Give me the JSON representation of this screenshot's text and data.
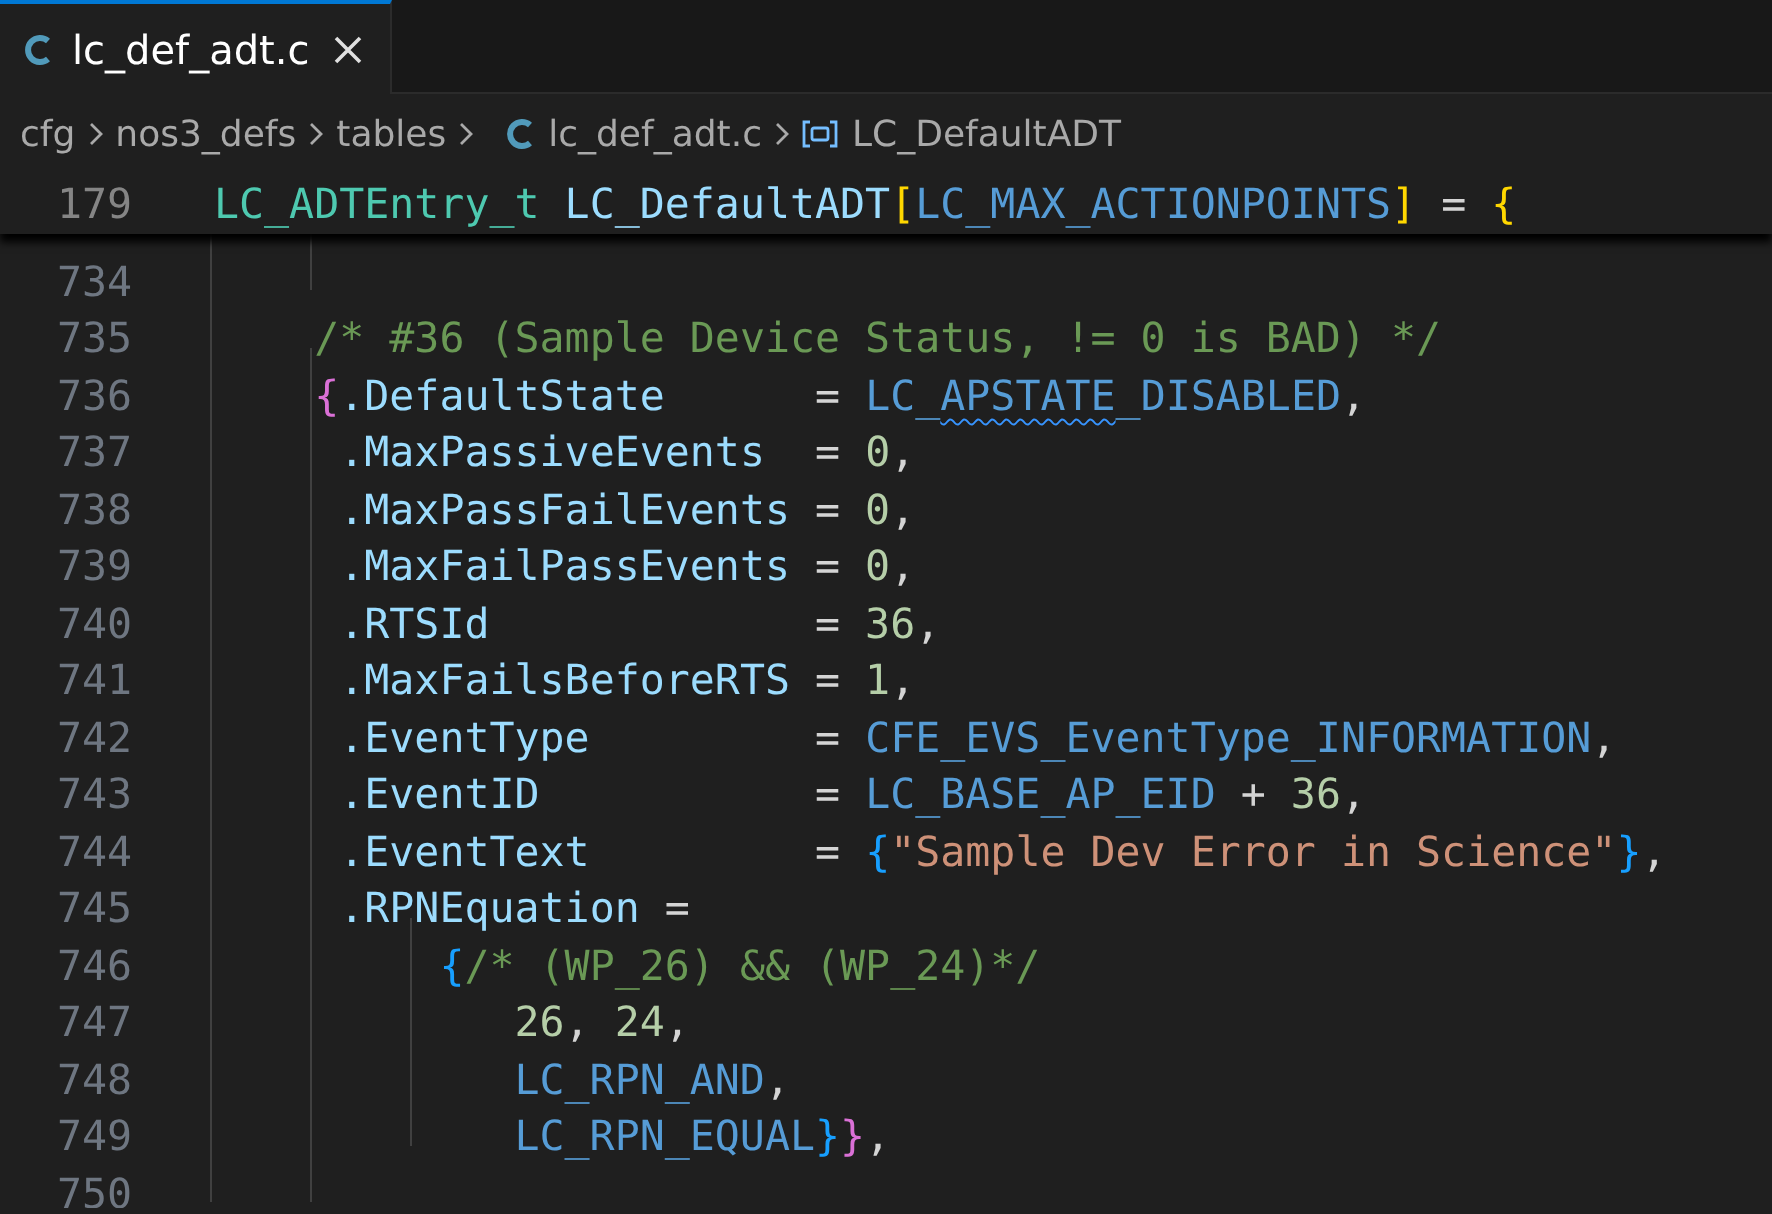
{
  "tabs": [
    {
      "label": "lc_def_adt.c",
      "selected": true
    }
  ],
  "breadcrumbs": [
    {
      "label": "cfg",
      "kind": "folder"
    },
    {
      "label": "nos3_defs",
      "kind": "folder"
    },
    {
      "label": "tables",
      "kind": "folder"
    },
    {
      "label": "lc_def_adt.c",
      "kind": "file"
    },
    {
      "label": "LC_DefaultADT",
      "kind": "symbol"
    }
  ],
  "sticky_line": {
    "number": "179",
    "tokens": [
      {
        "text": "LC_ADTEntry_t",
        "kind": "type"
      },
      {
        "text": " LC_DefaultADT",
        "kind": "variable"
      },
      {
        "text": "[",
        "kind": "bracket_gold"
      },
      {
        "text": "LC_MAX_ACTIONPOINTS",
        "kind": "macro"
      },
      {
        "text": "]",
        "kind": "bracket_gold"
      },
      {
        "text": " = ",
        "kind": "operator"
      },
      {
        "text": "{",
        "kind": "bracket_gold"
      }
    ]
  },
  "lines": [
    {
      "number": "734"
    },
    {
      "number": "735",
      "tokens": [
        {
          "text": "    /* #36 (Sample Device Status, != 0 is BAD) */",
          "kind": "comment"
        }
      ]
    },
    {
      "number": "736",
      "tokens": [
        {
          "text": "    {",
          "kind": "bracket_magenta"
        },
        {
          "text": ".DefaultState",
          "kind": "property"
        },
        {
          "text": "      = ",
          "kind": "operator"
        },
        {
          "text": "LC_",
          "kind": "macro"
        },
        {
          "text": "APSTATE",
          "kind": "macro",
          "warning": true
        },
        {
          "text": "_DISABLED",
          "kind": "macro"
        },
        {
          "text": ",",
          "kind": "operator"
        }
      ]
    },
    {
      "number": "737",
      "tokens": [
        {
          "text": "     .MaxPassiveEvents",
          "kind": "property"
        },
        {
          "text": "  = ",
          "kind": "operator"
        },
        {
          "text": "0",
          "kind": "number"
        },
        {
          "text": ",",
          "kind": "operator"
        }
      ]
    },
    {
      "number": "738",
      "tokens": [
        {
          "text": "     .MaxPassFailEvents",
          "kind": "property"
        },
        {
          "text": " = ",
          "kind": "operator"
        },
        {
          "text": "0",
          "kind": "number"
        },
        {
          "text": ",",
          "kind": "operator"
        }
      ]
    },
    {
      "number": "739",
      "tokens": [
        {
          "text": "     .MaxFailPassEvents",
          "kind": "property"
        },
        {
          "text": " = ",
          "kind": "operator"
        },
        {
          "text": "0",
          "kind": "number"
        },
        {
          "text": ",",
          "kind": "operator"
        }
      ]
    },
    {
      "number": "740",
      "tokens": [
        {
          "text": "     .RTSId",
          "kind": "property"
        },
        {
          "text": "             = ",
          "kind": "operator"
        },
        {
          "text": "36",
          "kind": "number"
        },
        {
          "text": ",",
          "kind": "operator"
        }
      ]
    },
    {
      "number": "741",
      "tokens": [
        {
          "text": "     .MaxFailsBeforeRTS",
          "kind": "property"
        },
        {
          "text": " = ",
          "kind": "operator"
        },
        {
          "text": "1",
          "kind": "number"
        },
        {
          "text": ",",
          "kind": "operator"
        }
      ]
    },
    {
      "number": "742",
      "tokens": [
        {
          "text": "     .EventType",
          "kind": "property"
        },
        {
          "text": "         = ",
          "kind": "operator"
        },
        {
          "text": "CFE_EVS_EventType_INFORMATION",
          "kind": "macro"
        },
        {
          "text": ",",
          "kind": "operator"
        }
      ]
    },
    {
      "number": "743",
      "tokens": [
        {
          "text": "     .EventID",
          "kind": "property"
        },
        {
          "text": "           = ",
          "kind": "operator"
        },
        {
          "text": "LC_BASE_AP_EID",
          "kind": "macro"
        },
        {
          "text": " + ",
          "kind": "operator"
        },
        {
          "text": "36",
          "kind": "number"
        },
        {
          "text": ",",
          "kind": "operator"
        }
      ]
    },
    {
      "number": "744",
      "tokens": [
        {
          "text": "     .EventText",
          "kind": "property"
        },
        {
          "text": "         = ",
          "kind": "operator"
        },
        {
          "text": "{",
          "kind": "bracket_blue"
        },
        {
          "text": "\"Sample Dev Error in Science\"",
          "kind": "string"
        },
        {
          "text": "}",
          "kind": "bracket_blue"
        },
        {
          "text": ",",
          "kind": "operator"
        }
      ]
    },
    {
      "number": "745",
      "tokens": [
        {
          "text": "     .RPNEquation",
          "kind": "property"
        },
        {
          "text": " =",
          "kind": "operator"
        }
      ]
    },
    {
      "number": "746",
      "tokens": [
        {
          "text": "         {",
          "kind": "bracket_blue"
        },
        {
          "text": "/* (WP_26) && (WP_24)*/",
          "kind": "comment"
        }
      ]
    },
    {
      "number": "747",
      "tokens": [
        {
          "text": "            26",
          "kind": "number"
        },
        {
          "text": ", ",
          "kind": "operator"
        },
        {
          "text": "24",
          "kind": "number"
        },
        {
          "text": ",",
          "kind": "operator"
        }
      ]
    },
    {
      "number": "748",
      "tokens": [
        {
          "text": "            LC_RPN_AND",
          "kind": "macro"
        },
        {
          "text": ",",
          "kind": "operator"
        }
      ]
    },
    {
      "number": "749",
      "tokens": [
        {
          "text": "            LC_RPN_EQUAL",
          "kind": "macro"
        },
        {
          "text": "}",
          "kind": "bracket_blue"
        },
        {
          "text": "}",
          "kind": "bracket_magenta"
        },
        {
          "text": ",",
          "kind": "operator"
        }
      ]
    },
    {
      "number": "750"
    }
  ]
}
